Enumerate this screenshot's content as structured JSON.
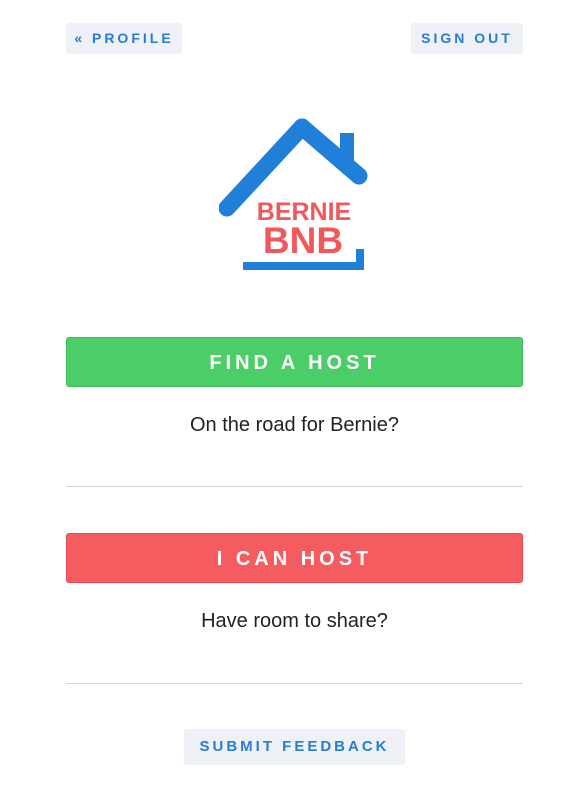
{
  "nav": {
    "profile_label": "« PROFILE",
    "signout_label": "SIGN OUT"
  },
  "logo": {
    "line1": "BERNIE",
    "line2": "BNB",
    "house_color": "#1f7fd9",
    "text_color": "#f0585c"
  },
  "find_host": {
    "button_label": "FIND A HOST",
    "prompt": "On the road for Bernie?",
    "color": "#4bce68"
  },
  "can_host": {
    "button_label": "I CAN HOST",
    "prompt": "Have room to share?",
    "color": "#f55c5f"
  },
  "feedback": {
    "button_label": "SUBMIT FEEDBACK"
  }
}
